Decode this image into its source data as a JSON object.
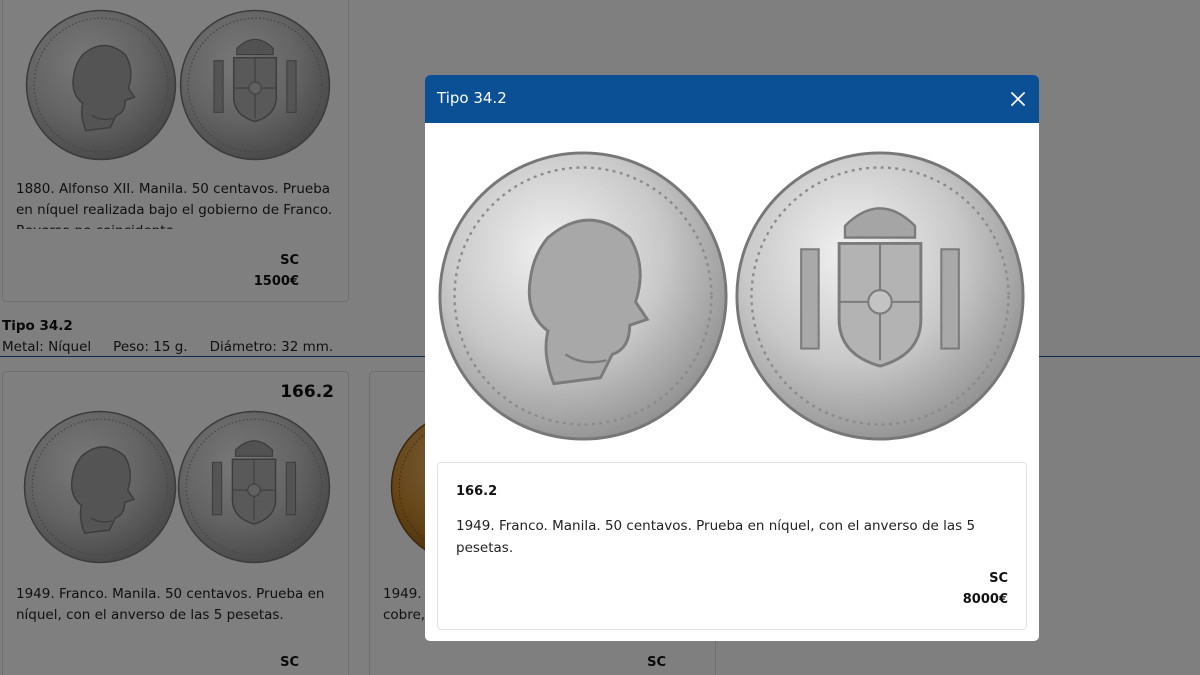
{
  "background": {
    "cards": [
      {
        "number": "",
        "description": "1880. Alfonso XII. Manila. 50 centavos. Prueba en níquel realizada bajo el gobierno de Franco. Reverso no coincidente.",
        "grade": "SC",
        "price": "1500€",
        "obverse_icon": "alfonso-xii-coin-icon",
        "reverse_icon": "shield-coin-icon"
      },
      {
        "number": "166.2",
        "description": "1949. Franco. Manila. 50 centavos. Prueba en níquel, con el anverso de las 5 pesetas.",
        "grade": "SC",
        "obverse_icon": "franco-coin-icon",
        "reverse_icon": "shield-coin-icon"
      },
      {
        "number": "",
        "description": "1949. Franco. Manila. 50 centavos. Prueba en cobre,",
        "grade": "SC",
        "obverse_icon": "copper-coin-icon"
      }
    ],
    "type_section": {
      "title": "Tipo 34.2",
      "metal": "Metal: Níquel",
      "weight": "Peso: 15 g.",
      "diameter": "Diámetro: 32 mm."
    }
  },
  "modal": {
    "title": "Tipo 34.2",
    "close_icon": "close-icon",
    "obverse_icon": "franco-coin-icon",
    "reverse_icon": "shield-coin-icon",
    "number": "166.2",
    "description": "1949. Franco. Manila. 50 centavos. Prueba en níquel, con el anverso de las 5 pesetas.",
    "grade": "SC",
    "price": "8000€"
  },
  "colors": {
    "header": "#0b4f94",
    "overlay": "rgba(0,0,0,0.5)",
    "silver": "#c9c9c9",
    "copper": "#c98a2e"
  }
}
